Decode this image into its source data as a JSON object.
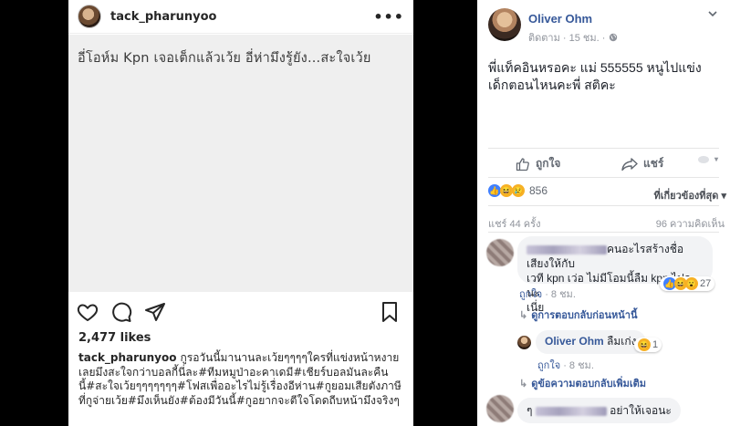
{
  "instagram": {
    "username": "tack_pharunyoo",
    "more_icon": "more-dots-icon",
    "image_text": "อี่โอห์ม Kpn เจอเต็กแล้วเว้ย อี่ห่ามึงรู้ยัง...สะใจเว้ย",
    "icons": [
      "heart-icon",
      "comment-icon",
      "share-icon",
      "bookmark-icon"
    ],
    "likes": "2,477 likes",
    "caption_user": "tack_pharunyoo",
    "caption_text": "กูรอวันนี้มานานละเว้ยๆๆๆๆใครที่แข่งหน้าหงายเลยมึงสะใจกว่าบอลกี้นี่ละ#ทีมหมูป่าอะคาเดมี#เชียร์บอลมันละคืนนี้#สะใจเว้ยๆๆๆๆๆๆๆ#โฟสเพื่ออะไรไม่รู้เรื่องอีห่าน#กูยอมเสียตังภาษีที่กูจ่ายเว้ย#มึงเห็นยัง#ต้องมีวันนี้#กูอยากจะตีใจโดดถีบหน้ามึงจริงๆ"
  },
  "facebook": {
    "author": "Oliver Ohm",
    "meta_follow": "ติดตาม",
    "meta_time": "· 15 ชม. ·",
    "post_text": "พี่แท็คอินหรอคะ แม่ 555555 หนูไปแข่งเด็กตอนไหนคะพี่ สติคะ",
    "like_label": "ถูกใจ",
    "share_label": "แชร์",
    "reaction_count": "856",
    "sort_label": "ที่เกี่ยวข้องที่สุด ▾",
    "shares_text": "แชร์ 44 ครั้ง",
    "comments_text": "96 ความคิดเห็น",
    "comment1": {
      "text_part1": "คนอะไรสร้างชื่อเสียงให้กับ",
      "text_part2": "เวที kpn เว่อ ไม่มีโอมนี้ลืม kpn ไปละนะ",
      "text_part3": "เนี่ย",
      "like": "ถูกใจ",
      "time": "· 8 ชม.",
      "reactions": "27",
      "previous_replies": "ดูการตอบกลับก่อนหน้านี้"
    },
    "reply1": {
      "author": "Oliver Ohm",
      "text": "ลืมเก่ง",
      "reactions": "1",
      "like": "ถูกใจ",
      "time": "· 8 ชม."
    },
    "more_replies": "ดูข้อความตอบกลับเพิ่มเติม",
    "comment2": {
      "prefix": "ๆ",
      "text": "อย่าให้เจอนะ"
    }
  }
}
